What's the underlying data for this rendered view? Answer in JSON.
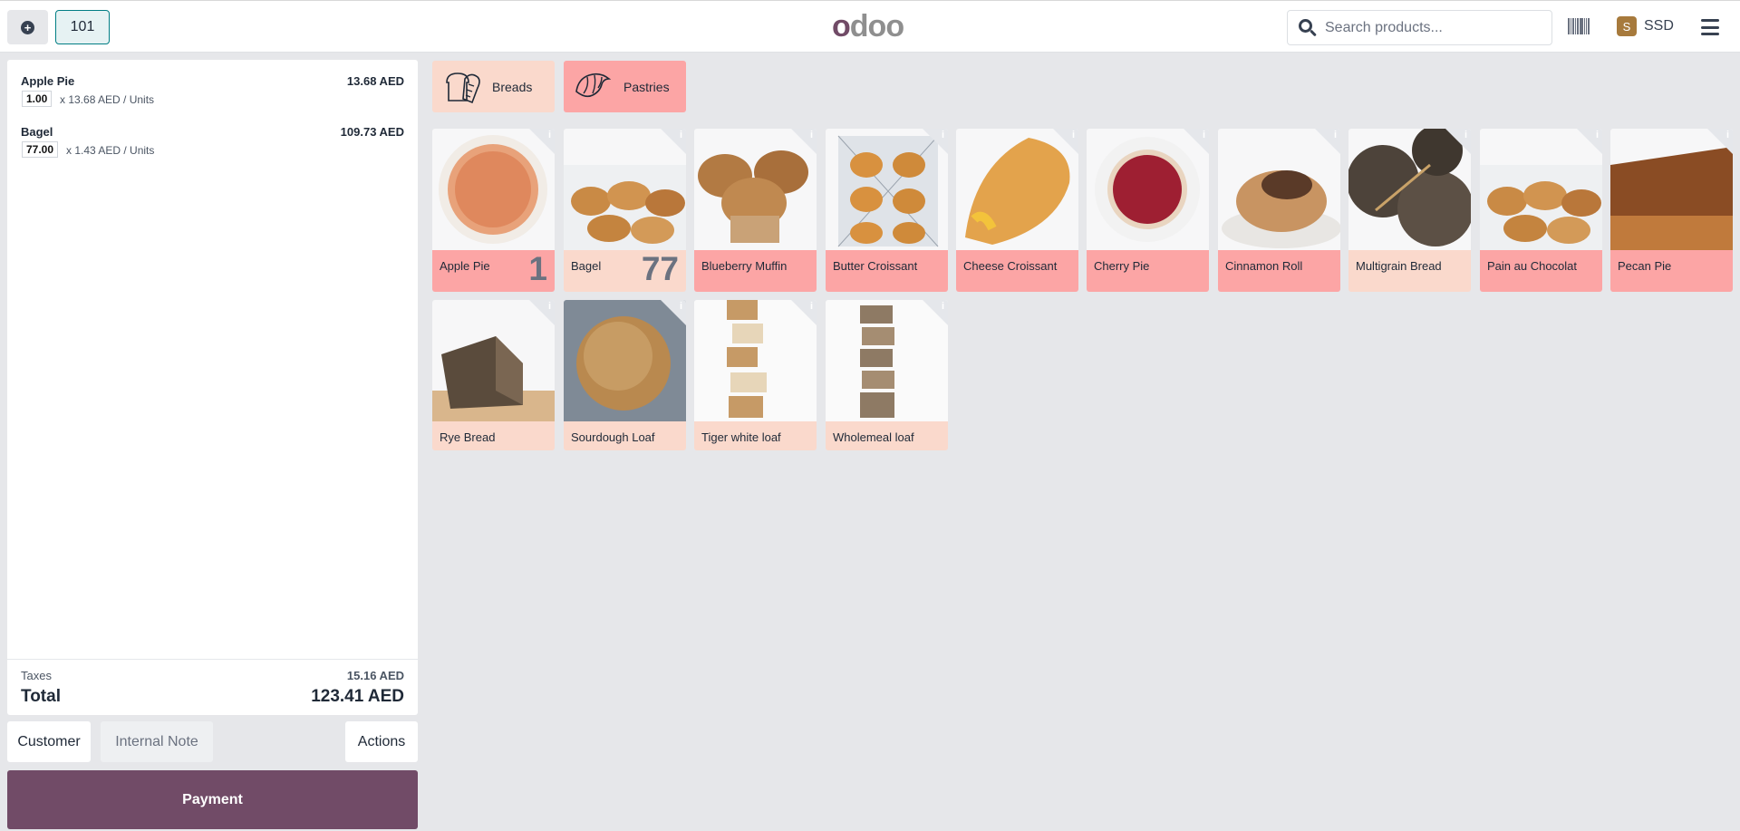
{
  "header": {
    "add_icon": "plus-circle-icon",
    "order_number": "101",
    "logo_first": "o",
    "logo_rest": "doo",
    "search_placeholder": "Search products...",
    "barcode_icon": "barcode-icon",
    "user_initial": "S",
    "user_name": "SSD",
    "menu_icon": "hamburger-menu-icon"
  },
  "order": {
    "lines": [
      {
        "name": "Apple Pie",
        "price": "13.68 AED",
        "qty": "1.00",
        "unit": "x 13.68 AED / Units"
      },
      {
        "name": "Bagel",
        "price": "109.73 AED",
        "qty": "77.00",
        "unit": "x 1.43 AED / Units"
      }
    ],
    "taxes_label": "Taxes",
    "taxes_value": "15.16 AED",
    "total_label": "Total",
    "total_value": "123.41 AED"
  },
  "controls": {
    "customer": "Customer",
    "internal_note": "Internal Note",
    "actions": "Actions",
    "payment": "Payment"
  },
  "categories": [
    {
      "label": "Breads",
      "icon": "bread-icon",
      "color": "#fad9cc"
    },
    {
      "label": "Pastries",
      "icon": "croissant-icon",
      "color": "#fca5a5"
    }
  ],
  "products": [
    {
      "name": "Apple Pie",
      "qty": "1"
    },
    {
      "name": "Bagel",
      "qty": "77"
    },
    {
      "name": "Blueberry Muffin",
      "qty": ""
    },
    {
      "name": "Butter Croissant",
      "qty": ""
    },
    {
      "name": "Cheese Croissant",
      "qty": ""
    },
    {
      "name": "Cherry Pie",
      "qty": ""
    },
    {
      "name": "Cinnamon Roll",
      "qty": ""
    },
    {
      "name": "Multigrain Bread",
      "qty": ""
    },
    {
      "name": "Pain au Chocolat",
      "qty": ""
    },
    {
      "name": "Pecan Pie",
      "qty": ""
    },
    {
      "name": "Rye Bread",
      "qty": ""
    },
    {
      "name": "Sourdough Loaf",
      "qty": ""
    },
    {
      "name": "Tiger white loaf",
      "qty": ""
    },
    {
      "name": "Wholemeal loaf",
      "qty": ""
    }
  ],
  "info_glyph": "i",
  "colors": {
    "brand": "#714b67",
    "pink": "#fca5a5",
    "light_pink": "#fad9cc",
    "teal": "#017e84"
  }
}
